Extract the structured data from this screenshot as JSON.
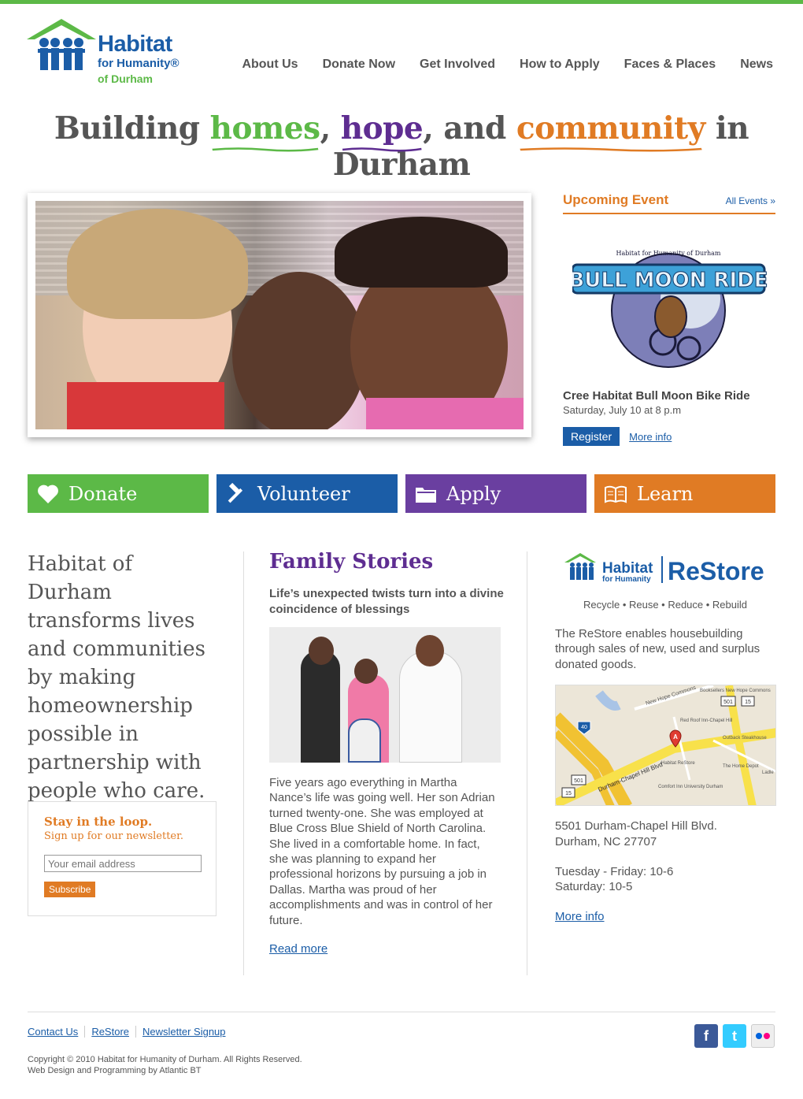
{
  "logo": {
    "line1": "Habitat",
    "line2": "for Humanity®",
    "line3": "of Durham"
  },
  "nav": [
    "About Us",
    "Donate Now",
    "Get Involved",
    "How to Apply",
    "Faces & Places",
    "News"
  ],
  "tagline": {
    "p1": "Building ",
    "w1": "homes",
    "p2": ", ",
    "w2": "hope",
    "p3": ", and ",
    "w3": "community",
    "p4": " in Durham"
  },
  "event": {
    "heading": "Upcoming Event",
    "all_link": "All Events »",
    "badge_title": "BULL MOON RIDE",
    "badge_arc": "Habitat for Humanity of Durham",
    "name": "Cree Habitat Bull Moon Bike Ride",
    "date": "Saturday, July 10 at 8 p.m",
    "register": "Register",
    "more": "More info"
  },
  "actions": [
    {
      "label": "Donate",
      "icon": "heart-icon",
      "color": "#5cb947"
    },
    {
      "label": "Volunteer",
      "icon": "hammer-icon",
      "color": "#1b5da7"
    },
    {
      "label": "Apply",
      "icon": "folder-icon",
      "color": "#6a3fa0"
    },
    {
      "label": "Learn",
      "icon": "book-icon",
      "color": "#e07b24"
    }
  ],
  "mission": "Habitat of Durham transforms lives and communities by making homeownership possible in partnership with people who care.",
  "newsletter": {
    "title": "Stay in the loop.",
    "subtitle": "Sign up for  our newsletter.",
    "placeholder": "Your email address",
    "button": "Subscribe"
  },
  "stories": {
    "title": "Family Stories",
    "subtitle": "Life’s unexpected twists turn into a divine coincidence of blessings",
    "body": "Five years ago everything in Martha Nance’s life was going well.  Her son Adrian turned twenty-one.  She was employed at Blue Cross Blue Shield of North Carolina. She lived in a comfortable home. In fact, she was planning to expand her professional horizons by pursuing a job in Dallas. Martha was proud of her accomplishments and was in control of her future.",
    "more": "Read more"
  },
  "restore": {
    "logo_habitat": "Habitat",
    "logo_humanity": "for Humanity",
    "logo_restore": "ReStore",
    "tagline": "Recycle • Reuse • Reduce • Rebuild",
    "desc": "The ReStore enables housebuilding through sales of new, used and surplus donated goods.",
    "map_labels": {
      "road": "Durham-Chapel Hill Blvd",
      "hope": "New Hope Commons",
      "books": "Booksellers New Hope Commons",
      "redroof": "Red Roof Inn-Chapel Hill",
      "outback": "Outback Steakhouse",
      "restore": "Habitat ReStore",
      "depot": "The Home Depot",
      "comfort": "Comfort Inn University Durham",
      "ladle": "Ladle",
      "hwy501a": "501",
      "hwy501b": "501",
      "hwy15a": "15",
      "hwy15b": "15",
      "hwy40": "40",
      "marker": "A"
    },
    "addr1": "5501 Durham-Chapel Hill Blvd.",
    "addr2": "Durham, NC 27707",
    "hours1": "Tuesday - Friday: 10-6",
    "hours2": "Saturday: 10-5",
    "more": "More info"
  },
  "footer": {
    "links": [
      "Contact Us",
      "ReStore",
      "Newsletter Signup"
    ],
    "social": [
      {
        "name": "facebook-icon",
        "glyph": "f"
      },
      {
        "name": "twitter-icon",
        "glyph": "t"
      },
      {
        "name": "flickr-icon",
        "glyph": "●●"
      }
    ],
    "copyright": "Copyright © 2010 Habitat for Humanity of Durham. All Rights Reserved.",
    "credit": "Web Design and Programming by Atlantic BT"
  },
  "colors": {
    "green": "#5cb947",
    "blue": "#1b5da7",
    "purple": "#5e2d91",
    "orange": "#e07b24"
  }
}
